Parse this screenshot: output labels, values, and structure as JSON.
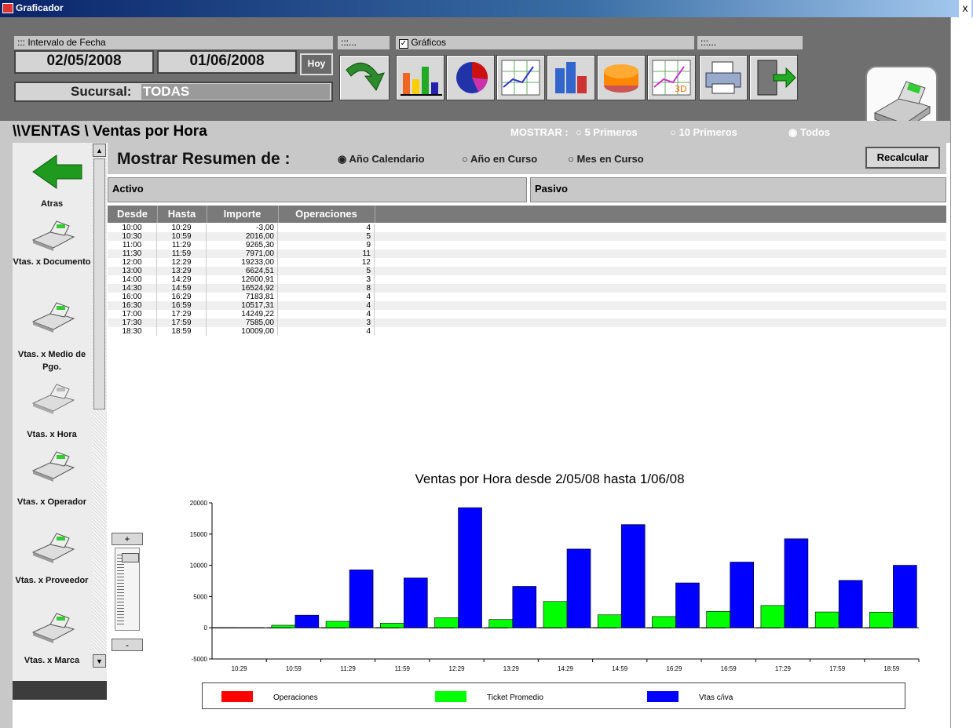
{
  "window": {
    "title": "Graficador",
    "close": "x"
  },
  "toolbar": {
    "interval_label": "::: Intervalo de Fecha",
    "date_from": "02/05/2008",
    "date_to": "01/06/2008",
    "today_button": "Hoy",
    "sucursal_label": "Sucursal:",
    "sucursal_value": "TODAS",
    "group2_label": ":::...",
    "graficos_label": "Gráficos",
    "graficos_checked": true,
    "group4_label": ":::..."
  },
  "heading": {
    "breadcrumb": "\\\\VENTAS \\ Ventas por Hora",
    "mostrar_label": "MOSTRAR :",
    "options": [
      "5 Primeros",
      "10 Primeros",
      "Todos"
    ],
    "selected": "Todos"
  },
  "nav": {
    "back_label": "Atras",
    "items": [
      "Vtas. x Documento",
      "Vtas. x Medio de Pgo.",
      "Vtas. x Hora",
      "Vtas. x Operador",
      "Vtas. x Proveedor",
      "Vtas. x Marca"
    ]
  },
  "summary": {
    "title": "Mostrar Resumen de :",
    "options": [
      "Año Calendario",
      "Año en Curso",
      "Mes en Curso"
    ],
    "selected": "Año Calendario",
    "recalc_button": "Recalcular"
  },
  "panels": {
    "left": "Activo",
    "right": "Pasivo"
  },
  "table": {
    "columns": [
      "Desde",
      "Hasta",
      "Importe",
      "Operaciones"
    ],
    "rows": [
      [
        "10:00",
        "10:29",
        "-3,00",
        "4"
      ],
      [
        "10:30",
        "10:59",
        "2016,00",
        "5"
      ],
      [
        "11:00",
        "11:29",
        "9265,30",
        "9"
      ],
      [
        "11:30",
        "11:59",
        "7971,00",
        "11"
      ],
      [
        "12:00",
        "12:29",
        "19233,00",
        "12"
      ],
      [
        "13:00",
        "13:29",
        "6624,51",
        "5"
      ],
      [
        "14:00",
        "14:29",
        "12600,91",
        "3"
      ],
      [
        "14:30",
        "14:59",
        "16524,92",
        "8"
      ],
      [
        "16:00",
        "16:29",
        "7183,81",
        "4"
      ],
      [
        "16:30",
        "16:59",
        "10517,31",
        "4"
      ],
      [
        "17:00",
        "17:29",
        "14249,22",
        "4"
      ],
      [
        "17:30",
        "17:59",
        "7585,00",
        "3"
      ],
      [
        "18:30",
        "18:59",
        "10009,00",
        "4"
      ]
    ]
  },
  "zoom": {
    "plus": "+",
    "minus": "-"
  },
  "chart_data": {
    "type": "bar",
    "title": "Ventas por Hora desde 2/05/08  hasta 1/06/08",
    "categories": [
      "10:29",
      "10:59",
      "11:29",
      "11:59",
      "12:29",
      "13:29",
      "14:29",
      "14:59",
      "16:29",
      "16:59",
      "17:29",
      "17:59",
      "18:59"
    ],
    "yticks": [
      20000,
      15000,
      10000,
      5000,
      0,
      -5000
    ],
    "ylim": [
      -5000,
      20000
    ],
    "series": [
      {
        "name": "Operaciones",
        "color": "#ff0000",
        "values": [
          4,
          5,
          9,
          11,
          12,
          5,
          3,
          8,
          4,
          4,
          4,
          3,
          4
        ]
      },
      {
        "name": "Ticket Promedio",
        "color": "#00ff00",
        "values": [
          -1,
          403,
          1029,
          725,
          1603,
          1325,
          4200,
          2066,
          1796,
          2629,
          3562,
          2528,
          2502
        ]
      },
      {
        "name": "Vtas c/iva",
        "color": "#0000ff",
        "values": [
          -3,
          2016,
          9265,
          7971,
          19233,
          6625,
          12601,
          16525,
          7184,
          10517,
          14249,
          7585,
          10009
        ]
      }
    ],
    "legend_position": "bottom"
  }
}
